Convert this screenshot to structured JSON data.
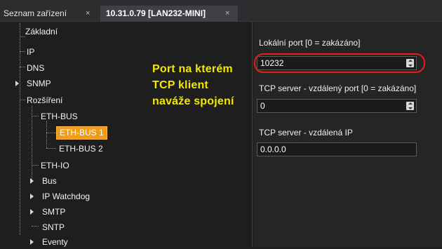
{
  "tabs": [
    {
      "label": "Seznam zařízení",
      "close": "×"
    },
    {
      "label": "10.31.0.79 [LAN232-MINI]",
      "close": "×"
    }
  ],
  "tree": {
    "items": [
      {
        "label": "Základní"
      },
      {
        "label": "IP"
      },
      {
        "label": "DNS"
      },
      {
        "label": "SNMP"
      },
      {
        "label": "Rozšíření"
      },
      {
        "label": "ETH-BUS"
      },
      {
        "label": "ETH-BUS 1",
        "selected": true
      },
      {
        "label": "ETH-BUS 2"
      },
      {
        "label": "ETH-IO"
      },
      {
        "label": "Bus"
      },
      {
        "label": "IP Watchdog"
      },
      {
        "label": "SMTP"
      },
      {
        "label": "SNTP"
      },
      {
        "label": "Eventy"
      }
    ]
  },
  "annotation": {
    "lines": [
      "Port na kterém",
      "TCP  klient",
      "naváže spojení"
    ],
    "color": "#f5e800"
  },
  "form": {
    "local_port": {
      "label": "Lokální port [0 = zakázáno]",
      "value": "10232"
    },
    "remote_port": {
      "label": "TCP server - vzdálený port [0 = zakázáno]",
      "value": "0"
    },
    "remote_ip": {
      "label": "TCP server - vzdálená IP",
      "value": "0.0.0.0"
    }
  },
  "colors": {
    "selection": "#f39c12",
    "highlight_ring": "#e81b1b",
    "background": "#1e1e1e"
  }
}
